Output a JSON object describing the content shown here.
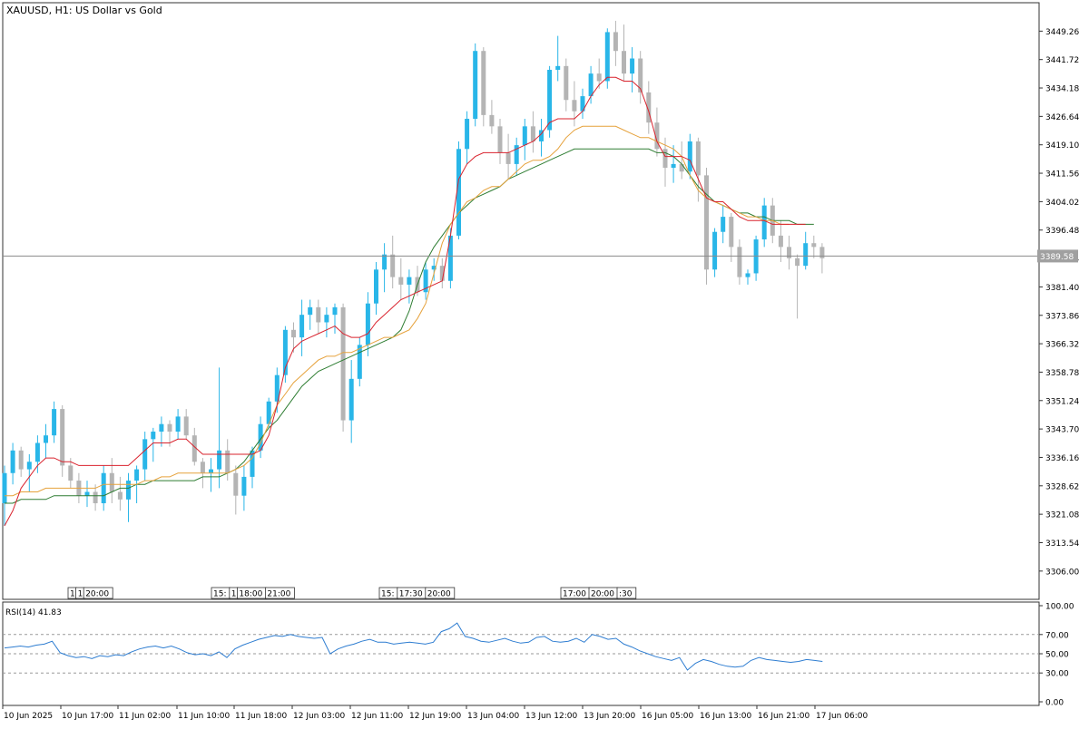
{
  "chart_data": {
    "type": "candlestick",
    "title": "XAUUSD, H1:  US Dollar vs Gold",
    "current_price": 3389.58,
    "price_line_label": "3389.58",
    "y_range": [
      3298.5,
      3456.8
    ],
    "y_ticks": [
      "3449.26",
      "3441.72",
      "3434.18",
      "3426.64",
      "3419.10",
      "3411.56",
      "3404.02",
      "3396.48",
      "3388.94",
      "3381.40",
      "3373.86",
      "3366.32",
      "3358.78",
      "3351.24",
      "3343.70",
      "3336.16",
      "3328.62",
      "3321.08",
      "3313.54",
      "3306.00"
    ],
    "x_labels": [
      "10 Jun 2025",
      "10 Jun 17:00",
      "11 Jun 02:00",
      "11 Jun 10:00",
      "11 Jun 18:00",
      "12 Jun 03:00",
      "12 Jun 11:00",
      "12 Jun 19:00",
      "13 Jun 04:00",
      "13 Jun 12:00",
      "13 Jun 20:00",
      "16 Jun 05:00",
      "16 Jun 13:00",
      "16 Jun 21:00",
      "17 Jun 06:00"
    ],
    "period_separator_tags": [
      [
        "1",
        "1",
        "20:00"
      ],
      [
        "15:",
        "1",
        "18:00",
        "21:00"
      ],
      [
        "15:",
        "17:30",
        "20:00"
      ],
      [
        "17:00",
        "20:00",
        ":30"
      ]
    ],
    "bull_color": "#29b6e8",
    "bear_color": "#b4b4b4",
    "ma_colors": [
      "#d9232e",
      "#e6a23c",
      "#2e7d32"
    ],
    "candles": [
      [
        3324.0,
        3334.0,
        3318.0,
        3332.0
      ],
      [
        3332.0,
        3340.0,
        3329.0,
        3338.0
      ],
      [
        3338.0,
        3339.0,
        3331.0,
        3333.0
      ],
      [
        3333.0,
        3337.0,
        3327.0,
        3335.0
      ],
      [
        3335.0,
        3342.0,
        3332.0,
        3340.0
      ],
      [
        3340.0,
        3345.0,
        3336.0,
        3342.0
      ],
      [
        3342.0,
        3351.0,
        3340.0,
        3349.0
      ],
      [
        3349.0,
        3350.0,
        3331.0,
        3334.0
      ],
      [
        3334.0,
        3336.0,
        3328.0,
        3330.0
      ],
      [
        3330.0,
        3332.0,
        3324.0,
        3326.0
      ],
      [
        3326.0,
        3330.0,
        3323.0,
        3327.0
      ],
      [
        3327.0,
        3329.0,
        3322.0,
        3324.0
      ],
      [
        3324.0,
        3334.0,
        3322.0,
        3332.0
      ],
      [
        3332.0,
        3336.0,
        3324.0,
        3327.0
      ],
      [
        3327.0,
        3331.0,
        3322.0,
        3325.0
      ],
      [
        3325.0,
        3332.0,
        3319.0,
        3330.0
      ],
      [
        3330.0,
        3334.0,
        3324.0,
        3333.0
      ],
      [
        3333.0,
        3343.0,
        3330.0,
        3341.0
      ],
      [
        3341.0,
        3344.0,
        3335.0,
        3343.0
      ],
      [
        3343.0,
        3347.0,
        3339.0,
        3345.0
      ],
      [
        3345.0,
        3346.0,
        3339.0,
        3343.0
      ],
      [
        3343.0,
        3349.0,
        3341.0,
        3347.0
      ],
      [
        3347.0,
        3349.0,
        3341.0,
        3342.0
      ],
      [
        3342.0,
        3344.0,
        3334.0,
        3335.0
      ],
      [
        3335.0,
        3336.0,
        3328.0,
        3332.0
      ],
      [
        3332.0,
        3336.0,
        3327.0,
        3333.0
      ],
      [
        3333.0,
        3360.0,
        3328.0,
        3338.0
      ],
      [
        3338.0,
        3341.0,
        3330.0,
        3332.0
      ],
      [
        3332.0,
        3334.0,
        3321.0,
        3326.0
      ],
      [
        3326.0,
        3334.0,
        3322.0,
        3331.0
      ],
      [
        3331.0,
        3339.0,
        3328.0,
        3338.0
      ],
      [
        3338.0,
        3347.0,
        3336.0,
        3345.0
      ],
      [
        3345.0,
        3352.0,
        3344.0,
        3351.0
      ],
      [
        3351.0,
        3360.0,
        3348.0,
        3358.0
      ],
      [
        3358.0,
        3371.0,
        3356.0,
        3370.0
      ],
      [
        3370.0,
        3372.0,
        3364.0,
        3368.0
      ],
      [
        3368.0,
        3378.0,
        3363.0,
        3374.0
      ],
      [
        3374.0,
        3378.0,
        3370.0,
        3376.0
      ],
      [
        3376.0,
        3378.0,
        3369.0,
        3372.0
      ],
      [
        3372.0,
        3376.0,
        3368.0,
        3374.0
      ],
      [
        3374.0,
        3377.0,
        3369.0,
        3376.0
      ],
      [
        3376.0,
        3377.0,
        3343.0,
        3346.0
      ],
      [
        3346.0,
        3362.0,
        3340.0,
        3357.0
      ],
      [
        3357.0,
        3368.0,
        3355.0,
        3366.0
      ],
      [
        3366.0,
        3380.0,
        3363.0,
        3377.0
      ],
      [
        3377.0,
        3388.0,
        3374.0,
        3386.0
      ],
      [
        3386.0,
        3393.0,
        3380.0,
        3390.0
      ],
      [
        3390.0,
        3395.0,
        3381.0,
        3384.0
      ],
      [
        3384.0,
        3389.0,
        3378.0,
        3382.0
      ],
      [
        3382.0,
        3386.0,
        3377.0,
        3384.0
      ],
      [
        3384.0,
        3387.0,
        3379.0,
        3380.0
      ],
      [
        3380.0,
        3388.0,
        3378.0,
        3386.0
      ],
      [
        3386.0,
        3389.0,
        3383.0,
        3387.0
      ],
      [
        3387.0,
        3389.0,
        3381.0,
        3383.0
      ],
      [
        3383.0,
        3397.0,
        3381.0,
        3395.0
      ],
      [
        3395.0,
        3420.0,
        3394.0,
        3418.0
      ],
      [
        3418.0,
        3428.0,
        3414.0,
        3426.0
      ],
      [
        3426.0,
        3446.0,
        3424.0,
        3444.0
      ],
      [
        3444.0,
        3445.0,
        3424.0,
        3427.0
      ],
      [
        3427.0,
        3431.0,
        3422.0,
        3424.0
      ],
      [
        3424.0,
        3426.0,
        3414.0,
        3417.0
      ],
      [
        3417.0,
        3422.0,
        3410.0,
        3414.0
      ],
      [
        3414.0,
        3421.0,
        3411.0,
        3419.0
      ],
      [
        3419.0,
        3426.0,
        3415.0,
        3424.0
      ],
      [
        3424.0,
        3428.0,
        3417.0,
        3420.0
      ],
      [
        3420.0,
        3426.0,
        3416.0,
        3423.0
      ],
      [
        3423.0,
        3440.0,
        3421.0,
        3439.0
      ],
      [
        3439.0,
        3448.0,
        3436.0,
        3440.0
      ],
      [
        3440.0,
        3442.0,
        3428.0,
        3431.0
      ],
      [
        3431.0,
        3436.0,
        3424.0,
        3428.0
      ],
      [
        3428.0,
        3434.0,
        3426.0,
        3432.0
      ],
      [
        3432.0,
        3440.0,
        3430.0,
        3438.0
      ],
      [
        3438.0,
        3442.0,
        3434.0,
        3436.0
      ],
      [
        3436.0,
        3450.0,
        3434.0,
        3449.0
      ],
      [
        3449.0,
        3452.0,
        3440.0,
        3444.0
      ],
      [
        3444.0,
        3451.0,
        3436.0,
        3438.0
      ],
      [
        3438.0,
        3445.0,
        3433.0,
        3442.0
      ],
      [
        3442.0,
        3444.0,
        3430.0,
        3433.0
      ],
      [
        3433.0,
        3436.0,
        3422.0,
        3425.0
      ],
      [
        3425.0,
        3429.0,
        3416.0,
        3418.0
      ],
      [
        3418.0,
        3421.0,
        3408.0,
        3413.0
      ],
      [
        3413.0,
        3419.0,
        3409.0,
        3414.0
      ],
      [
        3414.0,
        3420.0,
        3410.0,
        3412.0
      ],
      [
        3412.0,
        3422.0,
        3410.0,
        3420.0
      ],
      [
        3420.0,
        3421.0,
        3404.0,
        3411.0
      ],
      [
        3411.0,
        3413.0,
        3382.0,
        3386.0
      ],
      [
        3386.0,
        3397.0,
        3384.0,
        3396.0
      ],
      [
        3396.0,
        3403.0,
        3393.0,
        3400.0
      ],
      [
        3400.0,
        3401.0,
        3388.0,
        3392.0
      ],
      [
        3392.0,
        3394.0,
        3382.0,
        3384.0
      ],
      [
        3384.0,
        3386.0,
        3382.0,
        3385.0
      ],
      [
        3385.0,
        3395.0,
        3383.0,
        3394.0
      ],
      [
        3394.0,
        3405.0,
        3392.0,
        3403.0
      ],
      [
        3403.0,
        3405.0,
        3393.0,
        3395.0
      ],
      [
        3395.0,
        3399.0,
        3388.0,
        3392.0
      ],
      [
        3392.0,
        3395.0,
        3386.0,
        3389.0
      ],
      [
        3389.0,
        3390.0,
        3373.0,
        3387.0
      ],
      [
        3387.0,
        3396.0,
        3386.0,
        3393.0
      ],
      [
        3393.0,
        3395.0,
        3389.0,
        3392.0
      ],
      [
        3392.0,
        3393.0,
        3385.0,
        3389.0
      ]
    ],
    "ma_red": [
      3318.0,
      3322.0,
      3328.0,
      3331.0,
      3334.0,
      3336.0,
      3336.0,
      3335.0,
      3335.0,
      3334.0,
      3334.0,
      3334.0,
      3334.0,
      3334.0,
      3334.0,
      3334.0,
      3336.0,
      3338.0,
      3340.0,
      3340.0,
      3340.0,
      3341.0,
      3341.0,
      3339.0,
      3337.0,
      3337.0,
      3337.0,
      3337.0,
      3337.0,
      3337.0,
      3337.0,
      3338.0,
      3342.0,
      3350.0,
      3360.0,
      3365.0,
      3367.0,
      3368.0,
      3369.0,
      3370.0,
      3371.0,
      3369.0,
      3368.0,
      3368.0,
      3369.0,
      3372.0,
      3374.0,
      3376.0,
      3378.0,
      3379.0,
      3380.0,
      3381.0,
      3382.0,
      3383.0,
      3395.0,
      3410.0,
      3414.0,
      3416.0,
      3417.0,
      3417.0,
      3417.0,
      3417.0,
      3418.0,
      3419.0,
      3420.0,
      3422.0,
      3425.0,
      3426.0,
      3426.0,
      3426.0,
      3428.0,
      3432.0,
      3435.0,
      3437.0,
      3437.0,
      3436.0,
      3436.0,
      3434.0,
      3428.0,
      3420.0,
      3416.0,
      3416.0,
      3416.0,
      3415.0,
      3410.0,
      3405.0,
      3404.0,
      3404.0,
      3402.0,
      3400.0,
      3399.0,
      3399.0,
      3399.0,
      3398.0,
      3398.0,
      3398.0,
      3398.0,
      3398.0
    ],
    "ma_orange": [
      3326.0,
      3326.0,
      3327.0,
      3327.0,
      3327.0,
      3328.0,
      3328.0,
      3328.0,
      3328.0,
      3328.0,
      3328.0,
      3328.0,
      3329.0,
      3329.0,
      3329.0,
      3329.0,
      3329.0,
      3330.0,
      3330.0,
      3331.0,
      3331.0,
      3332.0,
      3332.0,
      3332.0,
      3332.0,
      3332.0,
      3332.0,
      3332.0,
      3333.0,
      3334.0,
      3336.0,
      3340.0,
      3345.0,
      3350.0,
      3353.0,
      3356.0,
      3358.0,
      3360.0,
      3362.0,
      3363.0,
      3363.0,
      3364.0,
      3364.0,
      3365.0,
      3366.0,
      3367.0,
      3368.0,
      3368.0,
      3369.0,
      3370.0,
      3373.0,
      3377.0,
      3385.0,
      3393.0,
      3398.0,
      3401.0,
      3404.0,
      3405.0,
      3407.0,
      3408.0,
      3408.0,
      3410.0,
      3412.0,
      3414.0,
      3415.0,
      3415.0,
      3416.0,
      3418.0,
      3421.0,
      3423.0,
      3424.0,
      3424.0,
      3424.0,
      3424.0,
      3424.0,
      3423.0,
      3422.0,
      3421.0,
      3421.0,
      3420.0,
      3419.0,
      3418.0,
      3416.0,
      3411.0,
      3407.0,
      3405.0,
      3404.0,
      3403.0,
      3402.0,
      3401.0,
      3400.0,
      3400.0,
      3399.0,
      3399.0,
      3398.0,
      3398.0
    ],
    "ma_green": [
      3324.0,
      3324.0,
      3325.0,
      3325.0,
      3325.0,
      3325.0,
      3326.0,
      3326.0,
      3326.0,
      3326.0,
      3326.0,
      3326.0,
      3326.0,
      3327.0,
      3328.0,
      3328.0,
      3329.0,
      3329.0,
      3330.0,
      3330.0,
      3330.0,
      3330.0,
      3330.0,
      3330.0,
      3331.0,
      3331.0,
      3331.0,
      3332.0,
      3333.0,
      3335.0,
      3338.0,
      3341.0,
      3344.0,
      3346.0,
      3349.0,
      3352.0,
      3355.0,
      3357.0,
      3359.0,
      3360.0,
      3361.0,
      3362.0,
      3363.0,
      3364.0,
      3365.0,
      3366.0,
      3367.0,
      3368.0,
      3370.0,
      3375.0,
      3382.0,
      3388.0,
      3392.0,
      3395.0,
      3398.0,
      3401.0,
      3403.0,
      3405.0,
      3406.0,
      3407.0,
      3408.0,
      3410.0,
      3411.0,
      3412.0,
      3413.0,
      3414.0,
      3415.0,
      3416.0,
      3417.0,
      3418.0,
      3418.0,
      3418.0,
      3418.0,
      3418.0,
      3418.0,
      3418.0,
      3418.0,
      3418.0,
      3418.0,
      3417.0,
      3417.0,
      3416.0,
      3414.0,
      3411.0,
      3408.0,
      3406.0,
      3404.0,
      3403.0,
      3402.0,
      3401.0,
      3401.0,
      3400.0,
      3400.0,
      3399.0,
      3399.0,
      3399.0,
      3398.0,
      3398.0,
      3398.0
    ],
    "rsi": {
      "label": "RSI(14) 41.83",
      "levels": [
        70,
        50,
        30
      ],
      "y_ticks": [
        "100.00",
        "70.00",
        "50.00",
        "30.00",
        "0.00"
      ],
      "range": [
        0,
        100
      ],
      "color": "#2e7dd1",
      "values": [
        56,
        57,
        58,
        57,
        59,
        60,
        63,
        51,
        48,
        46,
        47,
        45,
        48,
        47,
        49,
        48,
        52,
        55,
        57,
        58,
        56,
        58,
        55,
        51,
        49,
        50,
        48,
        52,
        46,
        55,
        59,
        62,
        65,
        67,
        69,
        68,
        70,
        68,
        67,
        66,
        67,
        50,
        55,
        58,
        60,
        63,
        65,
        62,
        62,
        60,
        61,
        62,
        61,
        60,
        62,
        73,
        76,
        82,
        68,
        66,
        63,
        62,
        64,
        66,
        63,
        61,
        62,
        67,
        68,
        63,
        62,
        63,
        66,
        62,
        70,
        68,
        65,
        66,
        60,
        57,
        53,
        50,
        47,
        45,
        43,
        46,
        33,
        40,
        44,
        42,
        39,
        37,
        36,
        37,
        43,
        46,
        44,
        43,
        42,
        41,
        42,
        44,
        43,
        42
      ]
    }
  }
}
